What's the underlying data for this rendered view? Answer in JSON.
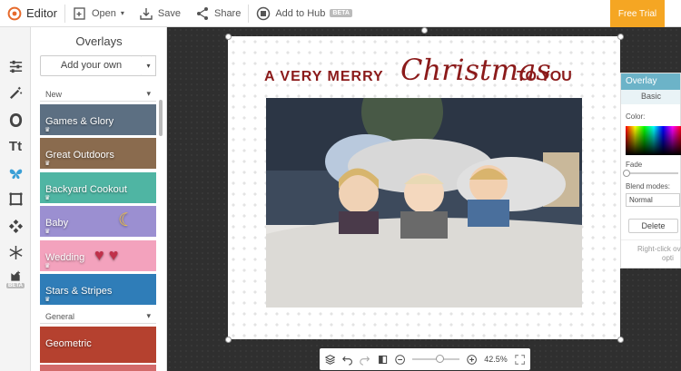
{
  "topbar": {
    "brand": "Editor",
    "open": "Open",
    "save": "Save",
    "share": "Share",
    "hub": "Add to Hub",
    "beta": "BETA",
    "free_trial": "Free Trial"
  },
  "iconbar": {
    "items": [
      "adjust-icon",
      "magic-wand-icon",
      "face-icon",
      "text-icon",
      "butterfly-icon",
      "frame-icon",
      "texture-icon",
      "snowflake-icon",
      "graphics-beta-icon"
    ],
    "beta": "BETA"
  },
  "panel": {
    "title": "Overlays",
    "add_own": "Add your own",
    "section_new": "New",
    "section_general": "General",
    "thumbs": [
      {
        "label": "Games & Glory",
        "color": "#5c6f82"
      },
      {
        "label": "Great Outdoors",
        "color": "#8a6b4e"
      },
      {
        "label": "Backyard Cookout",
        "color": "#4fb5a3"
      },
      {
        "label": "Baby",
        "color": "#9b8fd1"
      },
      {
        "label": "Wedding",
        "color": "#f3a2bd"
      },
      {
        "label": "Stars & Stripes",
        "color": "#2f7db8"
      },
      {
        "label": "Geometric",
        "color": "#b5412f"
      }
    ]
  },
  "document": {
    "title_left": "A VERY MERRY",
    "title_script": "Christmas",
    "title_right": "TO YOU"
  },
  "overlay_panel": {
    "title": "Overlay",
    "tab": "Basic",
    "color_label": "Color:",
    "fade_label": "Fade",
    "blend_label": "Blend modes:",
    "blend_value": "Normal",
    "delete": "Delete",
    "hint": "Right-click ov",
    "hint2": "opti"
  },
  "zoom": {
    "level": "42.5%"
  }
}
